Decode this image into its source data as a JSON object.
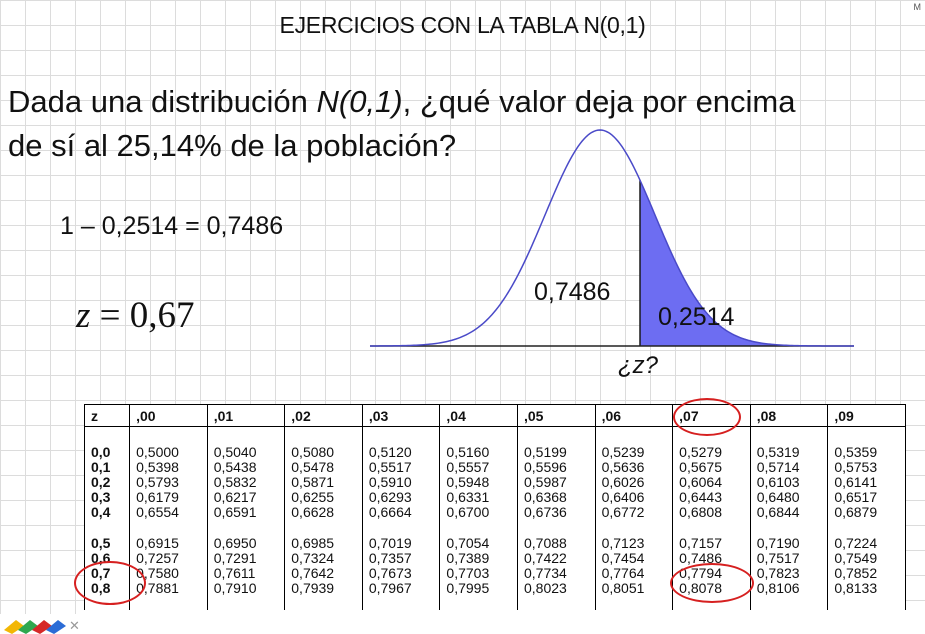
{
  "title": "EJERCICIOS CON LA TABLA  N(0,1)",
  "corner_mark": "M",
  "question": {
    "line1_pre": "Dada una distribución ",
    "line1_italic": "N(0,1)",
    "line1_post": ", ¿qué valor deja por encima",
    "line2": "de sí al 25,14% de la población?"
  },
  "equation1": "1 – 0,2514 = 0,7486",
  "equation2": {
    "var": "z",
    "rest": " = 0,67"
  },
  "graph": {
    "left_area_label": "0,7486",
    "right_area_label": "0,2514",
    "z_label": "¿z?"
  },
  "colors": {
    "shade": "#6d6df2",
    "curve": "#4a4ac8",
    "highlight": "#d62020"
  },
  "table": {
    "headers": [
      "z",
      ",00",
      ",01",
      ",02",
      ",03",
      ",04",
      ",05",
      ",06",
      ",07",
      ",08",
      ",09"
    ],
    "rows": [
      [
        "0,0",
        "0,5000",
        "0,5040",
        "0,5080",
        "0,5120",
        "0,5160",
        "0,5199",
        "0,5239",
        "0,5279",
        "0,5319",
        "0,5359"
      ],
      [
        "0,1",
        "0,5398",
        "0,5438",
        "0,5478",
        "0,5517",
        "0,5557",
        "0,5596",
        "0,5636",
        "0,5675",
        "0,5714",
        "0,5753"
      ],
      [
        "0,2",
        "0,5793",
        "0,5832",
        "0,5871",
        "0,5910",
        "0,5948",
        "0,5987",
        "0,6026",
        "0,6064",
        "0,6103",
        "0,6141"
      ],
      [
        "0,3",
        "0,6179",
        "0,6217",
        "0,6255",
        "0,6293",
        "0,6331",
        "0,6368",
        "0,6406",
        "0,6443",
        "0,6480",
        "0,6517"
      ],
      [
        "0,4",
        "0,6554",
        "0,6591",
        "0,6628",
        "0,6664",
        "0,6700",
        "0,6736",
        "0,6772",
        "0,6808",
        "0,6844",
        "0,6879"
      ],
      [
        "0,5",
        "0,6915",
        "0,6950",
        "0,6985",
        "0,7019",
        "0,7054",
        "0,7088",
        "0,7123",
        "0,7157",
        "0,7190",
        "0,7224"
      ],
      [
        "0,6",
        "0,7257",
        "0,7291",
        "0,7324",
        "0,7357",
        "0,7389",
        "0,7422",
        "0,7454",
        "0,7486",
        "0,7517",
        "0,7549"
      ],
      [
        "0,7",
        "0,7580",
        "0,7611",
        "0,7642",
        "0,7673",
        "0,7703",
        "0,7734",
        "0,7764",
        "0,7794",
        "0,7823",
        "0,7852"
      ],
      [
        "0,8",
        "0,7881",
        "0,7910",
        "0,7939",
        "0,7967",
        "0,7995",
        "0,8023",
        "0,8051",
        "0,8078",
        "0,8106",
        "0,8133"
      ]
    ],
    "highlight": {
      "header": ",07",
      "row": "0,6",
      "cell": "0,7486"
    }
  }
}
